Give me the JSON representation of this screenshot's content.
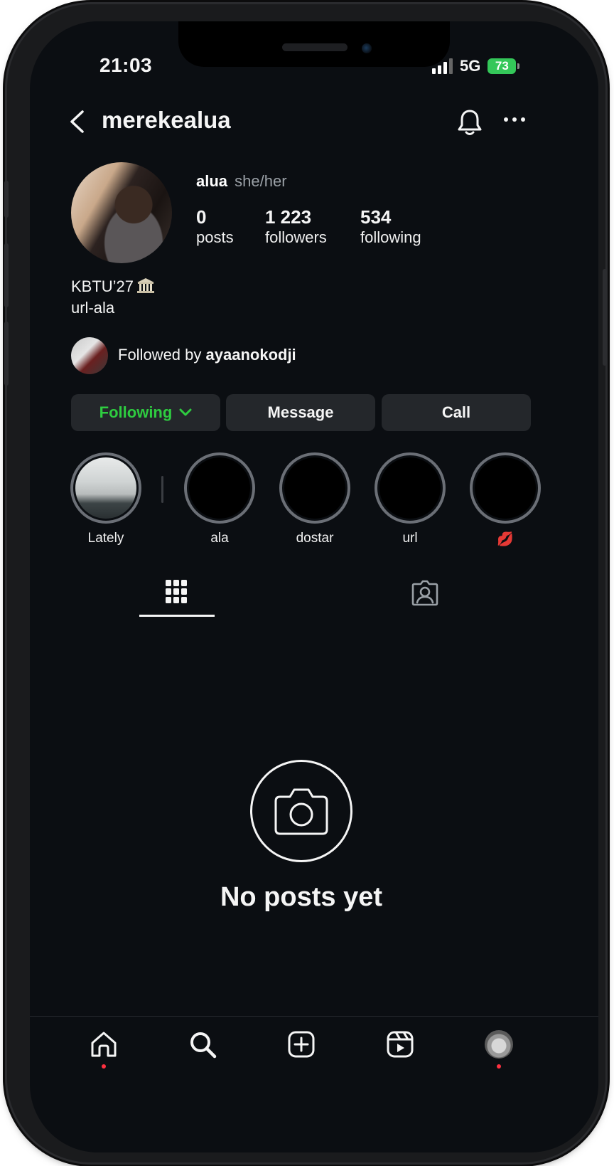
{
  "status_bar": {
    "time": "21:03",
    "network": "5G",
    "battery": "73"
  },
  "header": {
    "username": "merekealua"
  },
  "profile": {
    "name": "alua",
    "pronouns": "she/her",
    "stats": [
      {
        "value": "0",
        "label": "posts"
      },
      {
        "value": "1 223",
        "label": "followers"
      },
      {
        "value": "534",
        "label": "following"
      }
    ],
    "bio_line1": "KBTU’27",
    "bio_emoji": "classical-building-emoji",
    "bio_line2": "url-ala",
    "followed_by_prefix": "Followed by",
    "followed_by_user": "ayaanokodji"
  },
  "actions": {
    "following_label": "Following",
    "message_label": "Message",
    "call_label": "Call",
    "following_color": "#2ecc40"
  },
  "highlights": [
    {
      "label": "Lately"
    },
    {
      "label": "ala"
    },
    {
      "label": "dostar"
    },
    {
      "label": "url"
    },
    {
      "label": "💋"
    }
  ],
  "empty_state": {
    "title": "No posts yet"
  },
  "nav": {
    "items": [
      "home-icon",
      "search-icon",
      "create-icon",
      "reels-icon",
      "profile-avatar"
    ],
    "notification_dot_color": "#ff3040"
  },
  "theme": {
    "background": "#0b0e12",
    "button_bg": "#24272b"
  }
}
